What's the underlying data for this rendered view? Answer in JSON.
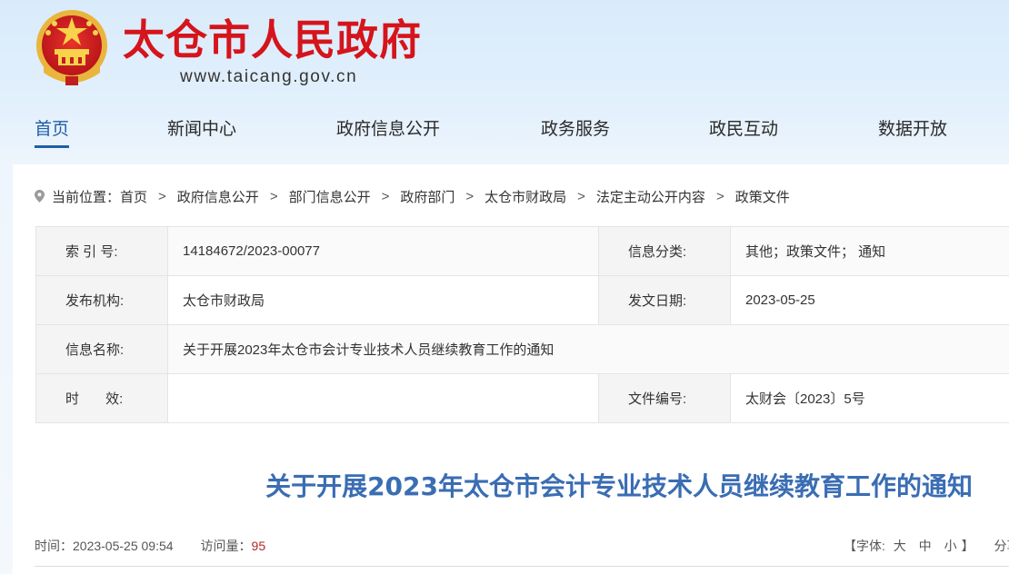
{
  "header": {
    "title": "太仓市人民政府",
    "url": "www.taicang.gov.cn",
    "emblem_icon": "national-emblem-icon",
    "title_color": "#d5141b"
  },
  "nav": {
    "items": [
      {
        "label": "首页",
        "active": true
      },
      {
        "label": "新闻中心"
      },
      {
        "label": "政府信息公开"
      },
      {
        "label": "政务服务"
      },
      {
        "label": "政民互动"
      },
      {
        "label": "数据开放"
      }
    ],
    "active_color": "#1f5ea8"
  },
  "breadcrumb": {
    "prefix": "当前位置：",
    "items": [
      "首页",
      "政府信息公开",
      "部门信息公开",
      "政府部门",
      "太仓市财政局",
      "法定主动公开内容",
      "政策文件"
    ],
    "separator": ">",
    "icon": "location-pin-icon"
  },
  "info": {
    "index_label": "索 引 号:",
    "index_value": "14184672/2023-00077",
    "category_label": "信息分类:",
    "category_value": "其他；政策文件； 通知",
    "publisher_label": "发布机构:",
    "publisher_value": "太仓市财政局",
    "date_label": "发文日期:",
    "date_value": "2023-05-25",
    "name_label": "信息名称:",
    "name_value": "关于开展2023年太仓市会计专业技术人员继续教育工作的通知",
    "validity_label": "时       效:",
    "validity_value": "",
    "docno_label": "文件编号:",
    "docno_value": "太财会〔2023〕5号"
  },
  "article": {
    "title": "关于开展2023年太仓市会计专业技术人员继续教育工作的通知",
    "title_color": "#3a6db3",
    "time_label": "时间：",
    "time_value": "2023-05-25 09:54",
    "visits_label": "访问量：",
    "visits_value": "95",
    "font_label": "【字体:",
    "font_large": "大",
    "font_medium": "中",
    "font_small": "小",
    "font_close": "】",
    "share_label": "分享到"
  }
}
